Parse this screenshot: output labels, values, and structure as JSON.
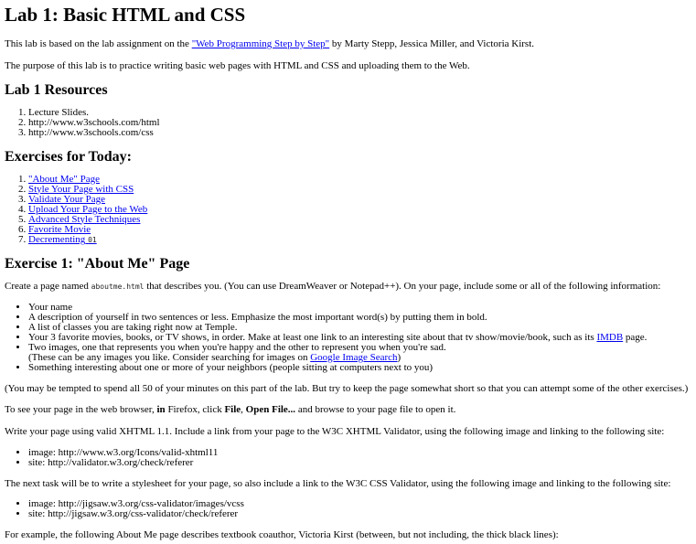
{
  "title": "Lab 1: Basic HTML and CSS",
  "intro": {
    "p1_before": "This lab is based on the lab assignment on the ",
    "p1_link": "\"Web Programming Step by Step\"",
    "p1_after": " by Marty Stepp, Jessica Miller, and Victoria Kirst.",
    "p2": "The purpose of this lab is to practice writing basic web pages with HTML and CSS and uploading them to the Web."
  },
  "resources": {
    "heading": "Lab 1 Resources",
    "items": [
      "Lecture Slides.",
      "http://www.w3schools.com/html",
      "http://www.w3schools.com/css"
    ]
  },
  "exercises": {
    "heading": "Exercises for Today:",
    "items": [
      "\"About Me\" Page",
      "Style Your Page with CSS",
      "Validate Your Page",
      "Upload Your Page to the Web",
      "Advanced Style Techniques",
      "Favorite Movie"
    ],
    "item7_text": "Decrementing",
    "item7_tag": "01"
  },
  "exercise1": {
    "heading": "Exercise 1: \"About Me\" Page",
    "intro_before": "Create a page named ",
    "intro_code": "aboutme.html",
    "intro_after": " that describes you. (You can use DreamWeaver or Notepad++). On your page, include some or all of the following information:",
    "list": {
      "i1": "Your name",
      "i2": "A description of yourself in two sentences or less. Emphasize the most important word(s) by putting them in bold.",
      "i3": "A list of classes you are taking right now at Temple.",
      "i4_before": "Your 3 favorite movies, books, or TV shows, in order. Make at least one link to an interesting site about that tv show/movie/book, such as its ",
      "i4_link": "IMDB",
      "i4_after": " page.",
      "i5_line1": "Two images, one that represents you when you're happy and the other to represent you when you're sad.",
      "i5_line2_before": "(These can be any images you like. Consider searching for images on ",
      "i5_link": "Google Image Search",
      "i5_line2_after": ")",
      "i6": "Something interesting about one or more of your neighbors (people sitting at computers next to you)"
    },
    "p_tempted": "(You may be tempted to spend all 50 of your minutes on this part of the lab. But try to keep the page somewhat short so that you can attempt some of the other exercises.)",
    "p_see_1": "To see your page in the web browser, ",
    "p_see_bold1": "in",
    "p_see_2": " Firefox, click ",
    "p_see_bold2": "File",
    "p_see_3": ", ",
    "p_see_bold3": "Open File...",
    "p_see_4": " and browse to your page file to open it.",
    "p_xhtml": "Write your page using valid XHTML 1.1. Include a link from your page to the W3C XHTML Validator, using the following image and linking to the following site:",
    "xhtml_list": [
      "image: http://www.w3.org/Icons/valid-xhtml11",
      "site: http://validator.w3.org/check/referer"
    ],
    "p_css": "The next task will be to write a stylesheet for your page, so also include a link to the W3C CSS Validator, using the following image and linking to the following site:",
    "css_list": [
      "image: http://jigsaw.w3.org/css-validator/images/vcss",
      "site: http://jigsaw.w3.org/css-validator/check/referer"
    ],
    "p_example": "For example, the following About Me page describes textbook coauthor, Victoria Kirst (between, but not including, the thick black lines):"
  }
}
